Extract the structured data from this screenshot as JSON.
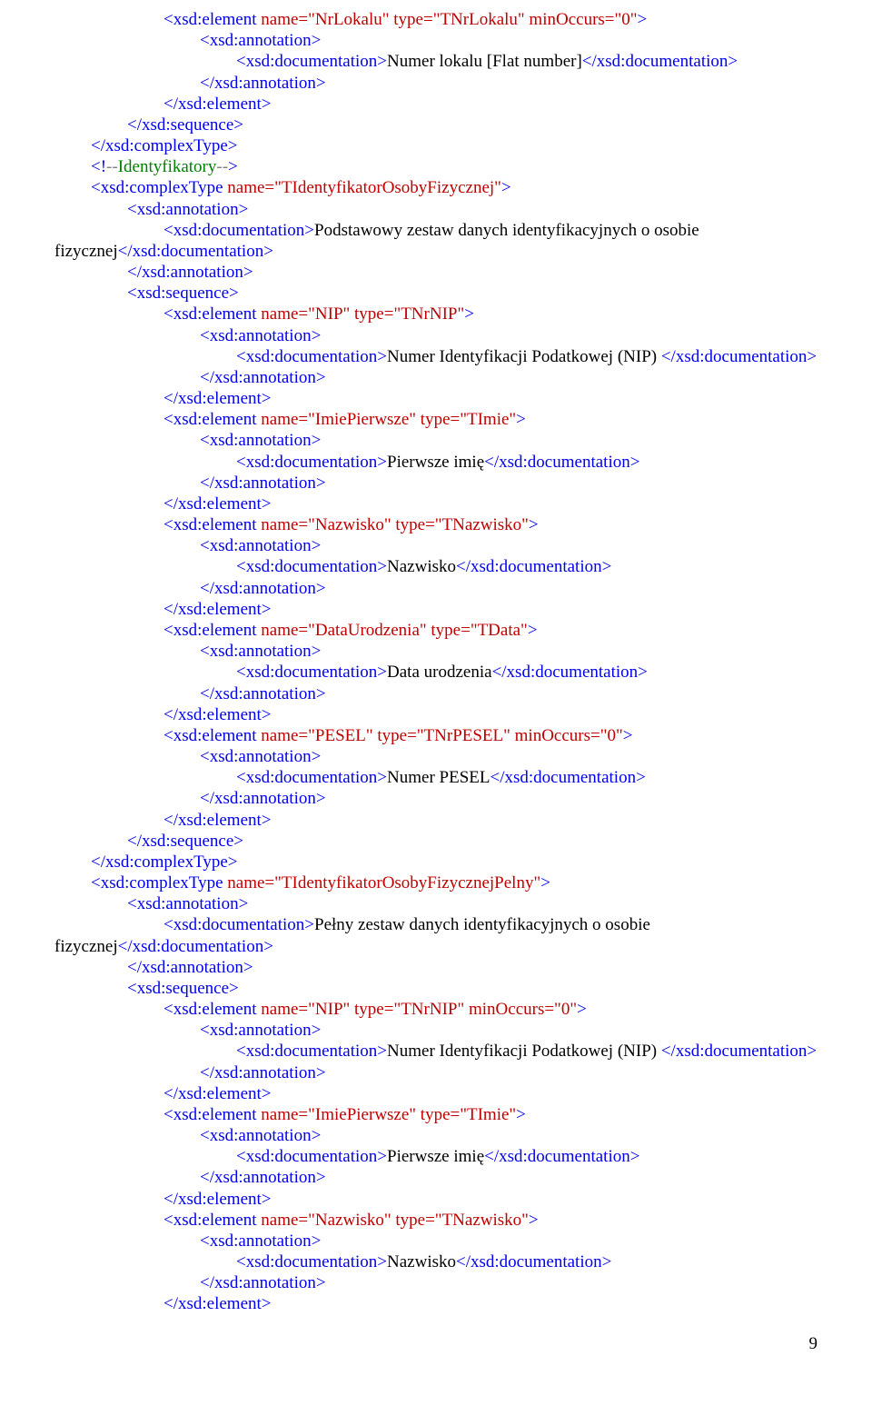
{
  "lines": [
    {
      "indent": 3,
      "segs": [
        {
          "c": "blue",
          "t": "<xsd:element"
        },
        {
          "c": "red",
          "t": " name=\"NrLokalu\" type=\"TNrLokalu\" minOccurs=\"0\""
        },
        {
          "c": "blue",
          "t": ">"
        }
      ]
    },
    {
      "indent": 4,
      "segs": [
        {
          "c": "blue",
          "t": "<xsd:annotation>"
        }
      ]
    },
    {
      "indent": 5,
      "segs": [
        {
          "c": "blue",
          "t": "<xsd:documentation>"
        },
        {
          "c": "black",
          "t": "Numer lokalu [Flat number]"
        },
        {
          "c": "blue",
          "t": "</xsd:documentation>"
        }
      ]
    },
    {
      "indent": 4,
      "segs": [
        {
          "c": "blue",
          "t": "</xsd:annotation>"
        }
      ]
    },
    {
      "indent": 3,
      "segs": [
        {
          "c": "blue",
          "t": "</xsd:element>"
        }
      ]
    },
    {
      "indent": 2,
      "segs": [
        {
          "c": "blue",
          "t": "</xsd:sequence>"
        }
      ]
    },
    {
      "indent": 1,
      "segs": [
        {
          "c": "blue",
          "t": "</xsd:complexType>"
        }
      ]
    },
    {
      "indent": 1,
      "segs": [
        {
          "c": "blue",
          "t": "<!"
        },
        {
          "c": "gray",
          "t": "--"
        },
        {
          "c": "green",
          "t": "Identyfikatory"
        },
        {
          "c": "gray",
          "t": "--"
        },
        {
          "c": "blue",
          "t": ">"
        }
      ]
    },
    {
      "indent": 1,
      "segs": [
        {
          "c": "blue",
          "t": "<xsd:complexType"
        },
        {
          "c": "red",
          "t": " name=\"TIdentyfikatorOsobyFizycznej\""
        },
        {
          "c": "blue",
          "t": ">"
        }
      ]
    },
    {
      "indent": 2,
      "segs": [
        {
          "c": "blue",
          "t": "<xsd:annotation>"
        }
      ]
    },
    {
      "indent": 3,
      "segs": [
        {
          "c": "blue",
          "t": "<xsd:documentation>"
        },
        {
          "c": "black",
          "t": "Podstawowy zestaw danych identyfikacyjnych o osobie "
        }
      ]
    },
    {
      "indent": 0,
      "segs": [
        {
          "c": "black",
          "t": "fizycznej"
        },
        {
          "c": "blue",
          "t": "</xsd:documentation>"
        }
      ]
    },
    {
      "indent": 2,
      "segs": [
        {
          "c": "blue",
          "t": "</xsd:annotation>"
        }
      ]
    },
    {
      "indent": 2,
      "segs": [
        {
          "c": "blue",
          "t": "<xsd:sequence>"
        }
      ]
    },
    {
      "indent": 3,
      "segs": [
        {
          "c": "blue",
          "t": "<xsd:element"
        },
        {
          "c": "red",
          "t": " name=\"NIP\" type=\"TNrNIP\""
        },
        {
          "c": "blue",
          "t": ">"
        }
      ]
    },
    {
      "indent": 4,
      "segs": [
        {
          "c": "blue",
          "t": "<xsd:annotation>"
        }
      ]
    },
    {
      "indent": 5,
      "segs": [
        {
          "c": "blue",
          "t": "<xsd:documentation>"
        },
        {
          "c": "black",
          "t": "Numer Identyfikacji Podatkowej (NIP) "
        },
        {
          "c": "blue",
          "t": "</xsd:documentation>"
        }
      ]
    },
    {
      "indent": 4,
      "segs": [
        {
          "c": "blue",
          "t": "</xsd:annotation>"
        }
      ]
    },
    {
      "indent": 3,
      "segs": [
        {
          "c": "blue",
          "t": "</xsd:element>"
        }
      ]
    },
    {
      "indent": 3,
      "segs": [
        {
          "c": "blue",
          "t": "<xsd:element"
        },
        {
          "c": "red",
          "t": " name=\"ImiePierwsze\" type=\"TImie\""
        },
        {
          "c": "blue",
          "t": ">"
        }
      ]
    },
    {
      "indent": 4,
      "segs": [
        {
          "c": "blue",
          "t": "<xsd:annotation>"
        }
      ]
    },
    {
      "indent": 5,
      "segs": [
        {
          "c": "blue",
          "t": "<xsd:documentation>"
        },
        {
          "c": "black",
          "t": "Pierwsze imię"
        },
        {
          "c": "blue",
          "t": "</xsd:documentation>"
        }
      ]
    },
    {
      "indent": 4,
      "segs": [
        {
          "c": "blue",
          "t": "</xsd:annotation>"
        }
      ]
    },
    {
      "indent": 3,
      "segs": [
        {
          "c": "blue",
          "t": "</xsd:element>"
        }
      ]
    },
    {
      "indent": 3,
      "segs": [
        {
          "c": "blue",
          "t": "<xsd:element"
        },
        {
          "c": "red",
          "t": " name=\"Nazwisko\" type=\"TNazwisko\""
        },
        {
          "c": "blue",
          "t": ">"
        }
      ]
    },
    {
      "indent": 4,
      "segs": [
        {
          "c": "blue",
          "t": "<xsd:annotation>"
        }
      ]
    },
    {
      "indent": 5,
      "segs": [
        {
          "c": "blue",
          "t": "<xsd:documentation>"
        },
        {
          "c": "black",
          "t": "Nazwisko"
        },
        {
          "c": "blue",
          "t": "</xsd:documentation>"
        }
      ]
    },
    {
      "indent": 4,
      "segs": [
        {
          "c": "blue",
          "t": "</xsd:annotation>"
        }
      ]
    },
    {
      "indent": 3,
      "segs": [
        {
          "c": "blue",
          "t": "</xsd:element>"
        }
      ]
    },
    {
      "indent": 3,
      "segs": [
        {
          "c": "blue",
          "t": "<xsd:element"
        },
        {
          "c": "red",
          "t": " name=\"DataUrodzenia\" type=\"TData\""
        },
        {
          "c": "blue",
          "t": ">"
        }
      ]
    },
    {
      "indent": 4,
      "segs": [
        {
          "c": "blue",
          "t": "<xsd:annotation>"
        }
      ]
    },
    {
      "indent": 5,
      "segs": [
        {
          "c": "blue",
          "t": "<xsd:documentation>"
        },
        {
          "c": "black",
          "t": "Data urodzenia"
        },
        {
          "c": "blue",
          "t": "</xsd:documentation>"
        }
      ]
    },
    {
      "indent": 4,
      "segs": [
        {
          "c": "blue",
          "t": "</xsd:annotation>"
        }
      ]
    },
    {
      "indent": 3,
      "segs": [
        {
          "c": "blue",
          "t": "</xsd:element>"
        }
      ]
    },
    {
      "indent": 3,
      "segs": [
        {
          "c": "blue",
          "t": "<xsd:element"
        },
        {
          "c": "red",
          "t": " name=\"PESEL\" type=\"TNrPESEL\" minOccurs=\"0\""
        },
        {
          "c": "blue",
          "t": ">"
        }
      ]
    },
    {
      "indent": 4,
      "segs": [
        {
          "c": "blue",
          "t": "<xsd:annotation>"
        }
      ]
    },
    {
      "indent": 5,
      "segs": [
        {
          "c": "blue",
          "t": "<xsd:documentation>"
        },
        {
          "c": "black",
          "t": "Numer PESEL"
        },
        {
          "c": "blue",
          "t": "</xsd:documentation>"
        }
      ]
    },
    {
      "indent": 4,
      "segs": [
        {
          "c": "blue",
          "t": "</xsd:annotation>"
        }
      ]
    },
    {
      "indent": 3,
      "segs": [
        {
          "c": "blue",
          "t": "</xsd:element>"
        }
      ]
    },
    {
      "indent": 2,
      "segs": [
        {
          "c": "blue",
          "t": "</xsd:sequence>"
        }
      ]
    },
    {
      "indent": 1,
      "segs": [
        {
          "c": "blue",
          "t": "</xsd:complexType>"
        }
      ]
    },
    {
      "indent": 1,
      "segs": [
        {
          "c": "blue",
          "t": "<xsd:complexType"
        },
        {
          "c": "red",
          "t": " name=\"TIdentyfikatorOsobyFizycznejPelny\""
        },
        {
          "c": "blue",
          "t": ">"
        }
      ]
    },
    {
      "indent": 2,
      "segs": [
        {
          "c": "blue",
          "t": "<xsd:annotation>"
        }
      ]
    },
    {
      "indent": 3,
      "segs": [
        {
          "c": "blue",
          "t": "<xsd:documentation>"
        },
        {
          "c": "black",
          "t": "Pełny zestaw danych identyfikacyjnych o osobie "
        }
      ]
    },
    {
      "indent": 0,
      "segs": [
        {
          "c": "black",
          "t": "fizycznej"
        },
        {
          "c": "blue",
          "t": "</xsd:documentation>"
        }
      ]
    },
    {
      "indent": 2,
      "segs": [
        {
          "c": "blue",
          "t": "</xsd:annotation>"
        }
      ]
    },
    {
      "indent": 2,
      "segs": [
        {
          "c": "blue",
          "t": "<xsd:sequence>"
        }
      ]
    },
    {
      "indent": 3,
      "segs": [
        {
          "c": "blue",
          "t": "<xsd:element"
        },
        {
          "c": "red",
          "t": " name=\"NIP\" type=\"TNrNIP\" minOccurs=\"0\""
        },
        {
          "c": "blue",
          "t": ">"
        }
      ]
    },
    {
      "indent": 4,
      "segs": [
        {
          "c": "blue",
          "t": "<xsd:annotation>"
        }
      ]
    },
    {
      "indent": 5,
      "segs": [
        {
          "c": "blue",
          "t": "<xsd:documentation>"
        },
        {
          "c": "black",
          "t": "Numer Identyfikacji Podatkowej (NIP) "
        },
        {
          "c": "blue",
          "t": "</xsd:documentation>"
        }
      ]
    },
    {
      "indent": 4,
      "segs": [
        {
          "c": "blue",
          "t": "</xsd:annotation>"
        }
      ]
    },
    {
      "indent": 3,
      "segs": [
        {
          "c": "blue",
          "t": "</xsd:element>"
        }
      ]
    },
    {
      "indent": 3,
      "segs": [
        {
          "c": "blue",
          "t": "<xsd:element"
        },
        {
          "c": "red",
          "t": " name=\"ImiePierwsze\" type=\"TImie\""
        },
        {
          "c": "blue",
          "t": ">"
        }
      ]
    },
    {
      "indent": 4,
      "segs": [
        {
          "c": "blue",
          "t": "<xsd:annotation>"
        }
      ]
    },
    {
      "indent": 5,
      "segs": [
        {
          "c": "blue",
          "t": "<xsd:documentation>"
        },
        {
          "c": "black",
          "t": "Pierwsze imię"
        },
        {
          "c": "blue",
          "t": "</xsd:documentation>"
        }
      ]
    },
    {
      "indent": 4,
      "segs": [
        {
          "c": "blue",
          "t": "</xsd:annotation>"
        }
      ]
    },
    {
      "indent": 3,
      "segs": [
        {
          "c": "blue",
          "t": "</xsd:element>"
        }
      ]
    },
    {
      "indent": 3,
      "segs": [
        {
          "c": "blue",
          "t": "<xsd:element"
        },
        {
          "c": "red",
          "t": " name=\"Nazwisko\" type=\"TNazwisko\""
        },
        {
          "c": "blue",
          "t": ">"
        }
      ]
    },
    {
      "indent": 4,
      "segs": [
        {
          "c": "blue",
          "t": "<xsd:annotation>"
        }
      ]
    },
    {
      "indent": 5,
      "segs": [
        {
          "c": "blue",
          "t": "<xsd:documentation>"
        },
        {
          "c": "black",
          "t": "Nazwisko"
        },
        {
          "c": "blue",
          "t": "</xsd:documentation>"
        }
      ]
    },
    {
      "indent": 4,
      "segs": [
        {
          "c": "blue",
          "t": "</xsd:annotation>"
        }
      ]
    },
    {
      "indent": 3,
      "segs": [
        {
          "c": "blue",
          "t": "</xsd:element>"
        }
      ]
    }
  ],
  "pageNumber": "9"
}
